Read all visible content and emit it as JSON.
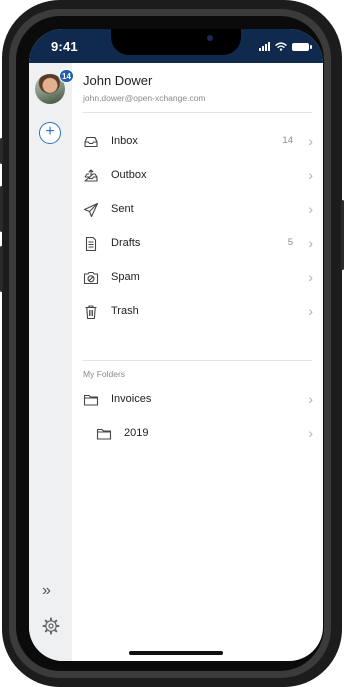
{
  "status_bar": {
    "time": "9:41"
  },
  "account": {
    "name": "John Dower",
    "email": "john.dower@open-xchange.com",
    "unread_badge": "14"
  },
  "rail": {
    "compose_symbol": "+",
    "expand_symbol": "»",
    "settings_icon": "gear-icon"
  },
  "folders": [
    {
      "label": "Inbox",
      "count": "14",
      "icon": "inbox-icon"
    },
    {
      "label": "Outbox",
      "count": "",
      "icon": "outbox-icon"
    },
    {
      "label": "Sent",
      "count": "",
      "icon": "send-icon"
    },
    {
      "label": "Drafts",
      "count": "5",
      "icon": "draft-icon"
    },
    {
      "label": "Spam",
      "count": "",
      "icon": "spam-icon"
    },
    {
      "label": "Trash",
      "count": "",
      "icon": "trash-icon"
    }
  ],
  "my_folders": {
    "heading": "My Folders",
    "items": [
      {
        "label": "Invoices",
        "icon": "folder-icon"
      },
      {
        "label": "2019",
        "icon": "folder-icon"
      }
    ]
  },
  "colors": {
    "status_bar": "#0f2a4d",
    "accent": "#2a72c9",
    "badge": "#1f5fa9",
    "rail_bg": "#eef0f2"
  }
}
